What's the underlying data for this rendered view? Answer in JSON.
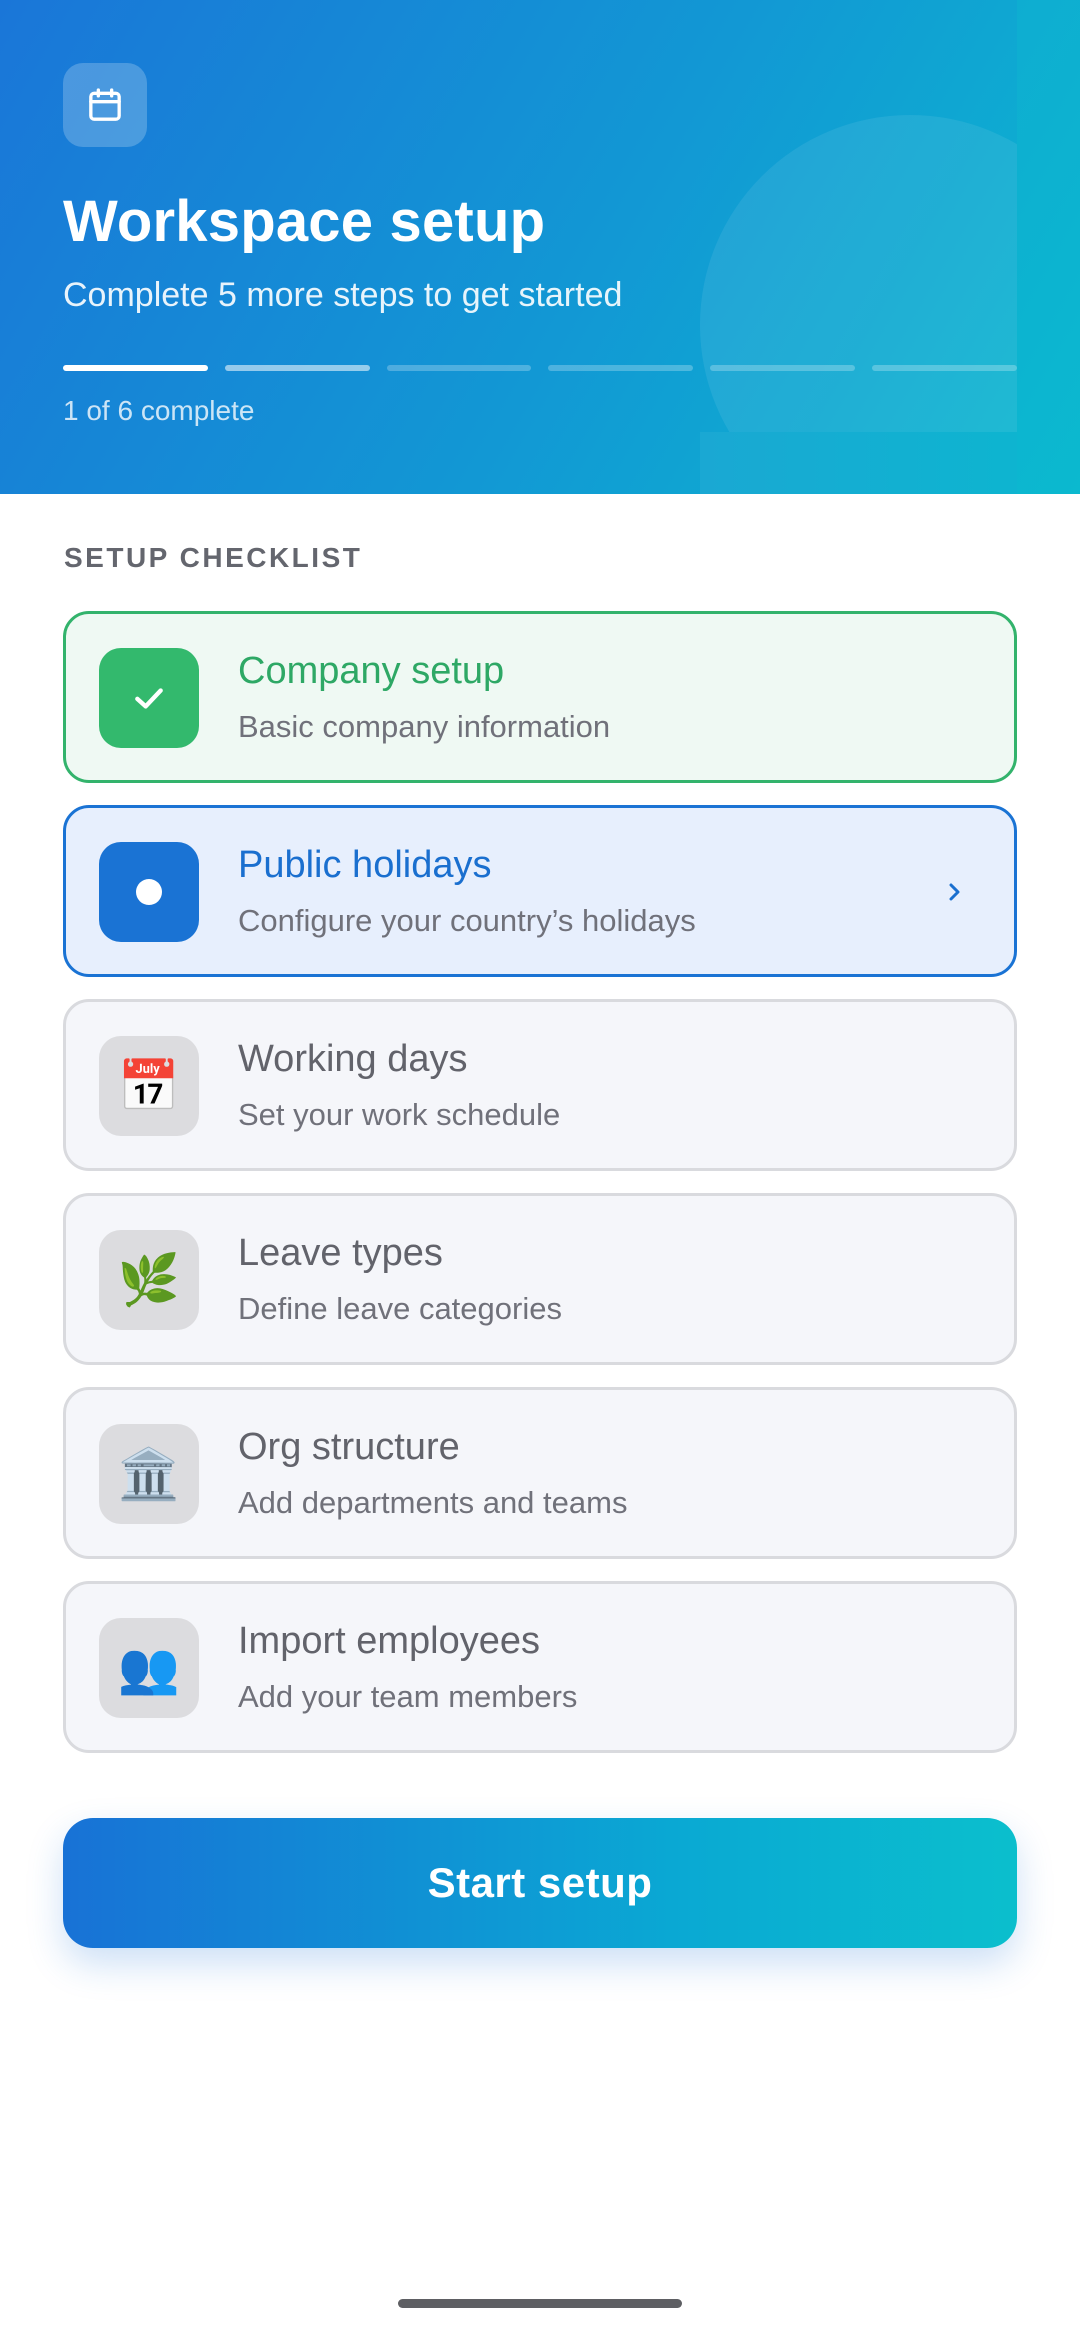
{
  "header": {
    "icon": "calendar-icon",
    "title": "Workspace setup",
    "subtitle": "Complete 5 more steps to get started",
    "progress": {
      "completed": 1,
      "total": 6,
      "label": "1 of 6 complete"
    }
  },
  "section": {
    "label": "SETUP CHECKLIST"
  },
  "steps": [
    {
      "title": "Company setup",
      "subtitle": "Basic company information",
      "status": "completed",
      "icon": "check-icon"
    },
    {
      "title": "Public holidays",
      "subtitle": "Configure your country’s holidays",
      "status": "current",
      "icon": "dot-icon"
    },
    {
      "title": "Working days",
      "subtitle": "Set your work schedule",
      "status": "pending",
      "icon": "calendar-emoji-icon",
      "glyph": "📅"
    },
    {
      "title": "Leave types",
      "subtitle": "Define leave categories",
      "status": "pending",
      "icon": "leaf-icon",
      "glyph": "🌿"
    },
    {
      "title": "Org structure",
      "subtitle": "Add departments and teams",
      "status": "pending",
      "icon": "building-icon",
      "glyph": "🏛️"
    },
    {
      "title": "Import employees",
      "subtitle": "Add your team members",
      "status": "pending",
      "icon": "people-icon",
      "glyph": "👥"
    }
  ],
  "cta": {
    "label": "Start setup"
  },
  "colors": {
    "primary": "#1a73d4",
    "success": "#33b96d",
    "gradient_end": "#0bbfcd"
  }
}
